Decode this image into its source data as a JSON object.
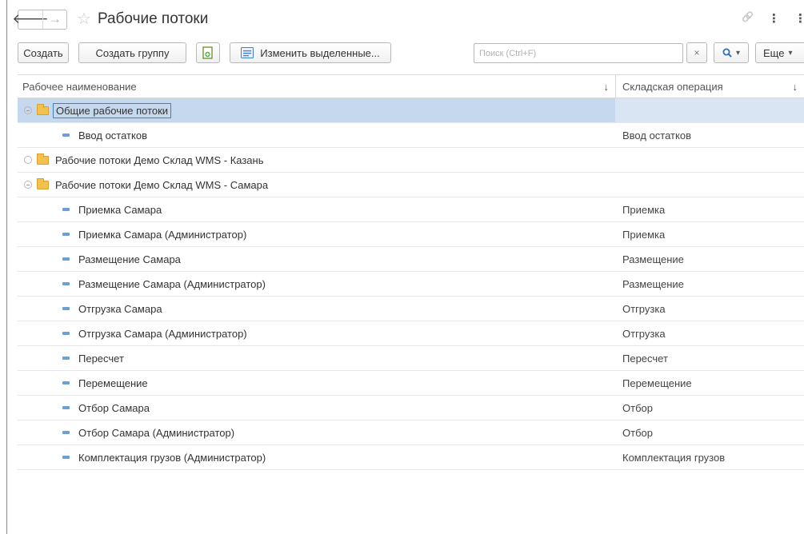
{
  "window": {
    "title": "Рабочие потоки"
  },
  "nav": {
    "back_glyph": "🡐",
    "forward_glyph": "→",
    "star_glyph": "☆",
    "link_glyph": "🔗",
    "more_glyph": "⋮",
    "clipped_glyph": "⋮"
  },
  "toolbar": {
    "create_label": "Создать",
    "create_group_label": "Создать группу",
    "edit_selected_label": "Изменить выделенные...",
    "search_placeholder": "Поиск (Ctrl+F)",
    "search_clear_glyph": "×",
    "search_icon_glyph": "🔍",
    "dropdown_glyph": "▾",
    "more_label": "Еще",
    "more_dropdown_glyph": "▾"
  },
  "table": {
    "columns": [
      {
        "label": "Рабочее наименование",
        "sort_glyph": "↓"
      },
      {
        "label": "Складская операция",
        "sort_glyph": "↓"
      }
    ],
    "rows": [
      {
        "type": "folder",
        "expanded": true,
        "name": "Общие рабочие потоки",
        "operation": "",
        "selected": true
      },
      {
        "type": "item",
        "name": "Ввод остатков",
        "operation": "Ввод остатков"
      },
      {
        "type": "folder",
        "expanded": false,
        "name": "Рабочие потоки Демо Склад WMS - Казань",
        "operation": ""
      },
      {
        "type": "folder",
        "expanded": true,
        "name": "Рабочие потоки Демо Склад WMS - Самара",
        "operation": ""
      },
      {
        "type": "item",
        "name": "Приемка Самара",
        "operation": "Приемка"
      },
      {
        "type": "item",
        "name": "Приемка Самара (Администратор)",
        "operation": "Приемка"
      },
      {
        "type": "item",
        "name": "Размещение Самара",
        "operation": "Размещение"
      },
      {
        "type": "item",
        "name": "Размещение Самара (Администратор)",
        "operation": "Размещение"
      },
      {
        "type": "item",
        "name": "Отгрузка Самара",
        "operation": "Отгрузка"
      },
      {
        "type": "item",
        "name": "Отгрузка Самара (Администратор)",
        "operation": "Отгрузка"
      },
      {
        "type": "item",
        "name": "Пересчет",
        "operation": "Пересчет"
      },
      {
        "type": "item",
        "name": "Перемещение",
        "operation": "Перемещение"
      },
      {
        "type": "item",
        "name": "Отбор Самара",
        "operation": "Отбор"
      },
      {
        "type": "item",
        "name": "Отбор Самара (Администратор)",
        "operation": "Отбор"
      },
      {
        "type": "item",
        "name": "Комплектация грузов (Администратор)",
        "operation": "Комплектация грузов"
      }
    ]
  },
  "colors": {
    "selection": "#c5d8ee",
    "accent": "#4a7ebb",
    "folder": "#f2c14e",
    "item_dash": "#6c9fd4"
  }
}
